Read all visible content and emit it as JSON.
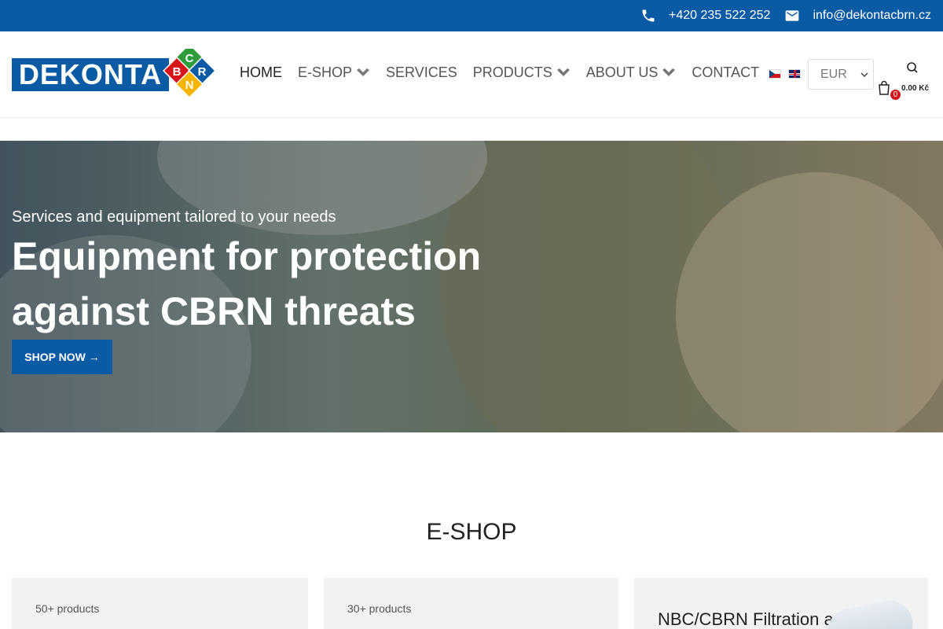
{
  "topbar": {
    "phone": "+420 235 522 252",
    "email": "info@dekontacbrn.cz",
    "phone_icon": "phone-icon",
    "email_icon": "mail-icon",
    "bg_color": "#0b5aa4"
  },
  "logo": {
    "text": "DEKONTA",
    "letters": [
      "C",
      "B",
      "R",
      "N"
    ],
    "colors": {
      "brand": "#0b5aa4",
      "c": "#2e9c3c",
      "b": "#d7141a",
      "r": "#0b5aa4",
      "n": "#f5b400"
    }
  },
  "nav": {
    "items": [
      {
        "label": "HOME",
        "dropdown": false
      },
      {
        "label": "E-SHOP",
        "dropdown": true
      },
      {
        "label": "SERVICES",
        "dropdown": false
      },
      {
        "label": "PRODUCTS",
        "dropdown": true
      },
      {
        "label": "ABOUT US",
        "dropdown": true
      },
      {
        "label": "CONTACT",
        "dropdown": false
      }
    ]
  },
  "languages": [
    "cz-flag",
    "en-flag"
  ],
  "currency": {
    "selected": "EUR"
  },
  "cart": {
    "count": "0",
    "total": "0.00 Kč"
  },
  "hero": {
    "subtitle": "Services and equipment tailored to your needs",
    "title": "Equipment for protection against CBRN threats",
    "button": "SHOP NOW →"
  },
  "section": {
    "title": "E-SHOP",
    "cards": [
      {
        "count": "50+ products",
        "title": ""
      },
      {
        "count": "30+ products",
        "title": ""
      },
      {
        "count": "",
        "title": "NBC/CBRN Filtration and"
      }
    ]
  }
}
